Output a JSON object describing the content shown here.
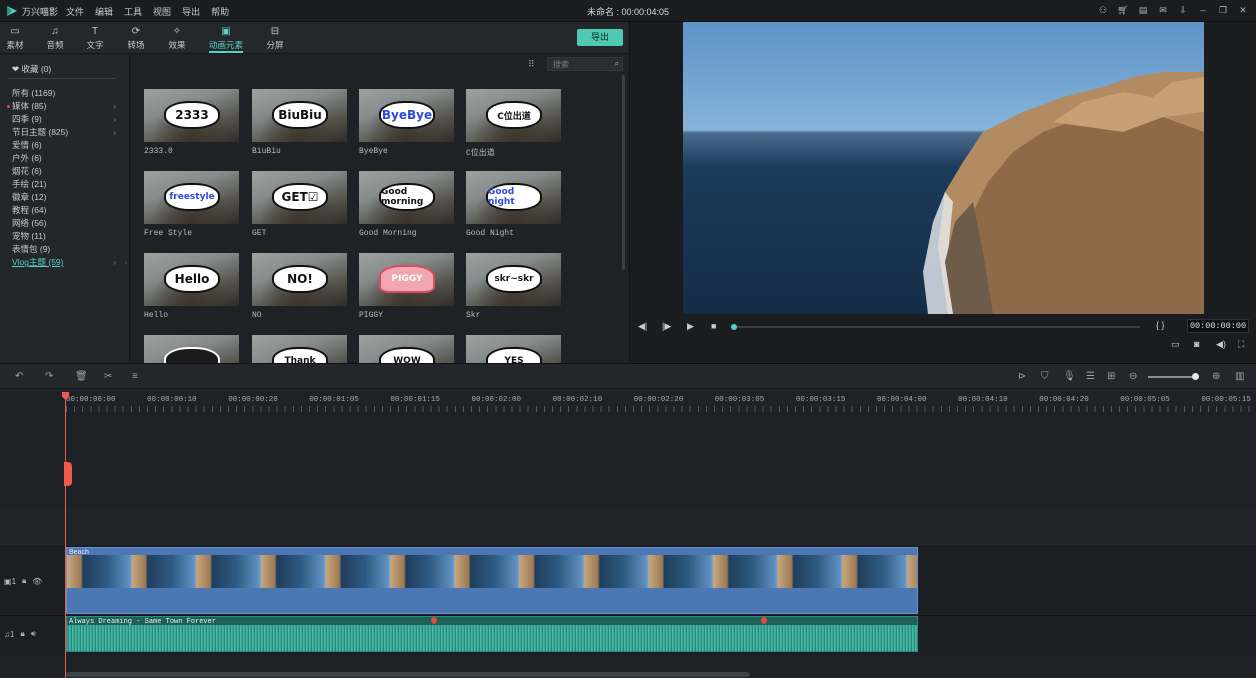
{
  "titlebar": {
    "app_name": "万兴喵影",
    "menu": [
      "文件",
      "编辑",
      "工具",
      "视图",
      "导出",
      "帮助"
    ],
    "window_title": "未命名 : 00:00:04:05"
  },
  "tabs": [
    {
      "label": "素材",
      "icon": "folder-icon",
      "glyph": "▭"
    },
    {
      "label": "音频",
      "icon": "music-note-icon",
      "glyph": "♫"
    },
    {
      "label": "文字",
      "icon": "text-icon",
      "glyph": "T"
    },
    {
      "label": "转场",
      "icon": "transition-icon",
      "glyph": "⟳"
    },
    {
      "label": "效果",
      "icon": "effects-icon",
      "glyph": "✧"
    },
    {
      "label": "动画元素",
      "icon": "image-icon",
      "glyph": "▣"
    },
    {
      "label": "分屏",
      "icon": "split-screen-icon",
      "glyph": "⊟"
    }
  ],
  "export_label": "导出",
  "sidebar": {
    "favorites": "收藏 (0)",
    "categories": [
      {
        "label": "所有 (1169)",
        "chev": ""
      },
      {
        "label": "媒体 (85)",
        "chev": "›"
      },
      {
        "label": "四季 (9)",
        "chev": "›"
      },
      {
        "label": "节日主题 (825)",
        "chev": "›"
      },
      {
        "label": "爱情 (6)",
        "chev": ""
      },
      {
        "label": "户外 (6)",
        "chev": ""
      },
      {
        "label": "烟花 (6)",
        "chev": ""
      },
      {
        "label": "手绘 (21)",
        "chev": ""
      },
      {
        "label": "徽章 (12)",
        "chev": ""
      },
      {
        "label": "教程 (64)",
        "chev": ""
      },
      {
        "label": "网络 (56)",
        "chev": ""
      },
      {
        "label": "宠物 (11)",
        "chev": ""
      },
      {
        "label": "表情包 (9)",
        "chev": ""
      },
      {
        "label": "Vlog主题 (59)",
        "chev": "›"
      }
    ]
  },
  "search": {
    "placeholder": "搜索"
  },
  "elements": [
    {
      "caption": "2333.0",
      "sticker": "2333",
      "style": ""
    },
    {
      "caption": "BiuBiu",
      "sticker": "BiuBiu",
      "style": ""
    },
    {
      "caption": "ByeBye",
      "sticker": "ByeBye",
      "style": "blue"
    },
    {
      "caption": "C位出道",
      "sticker": "C位出道",
      "style": "small"
    },
    {
      "caption": "Free Style",
      "sticker": "freestyle",
      "style": "small blue"
    },
    {
      "caption": "GET",
      "sticker": "GET☑",
      "style": ""
    },
    {
      "caption": "Good Morning",
      "sticker": "Good morning",
      "style": "small"
    },
    {
      "caption": "Good Night",
      "sticker": "Good night",
      "style": "small blue"
    },
    {
      "caption": "Hello",
      "sticker": "Hello",
      "style": ""
    },
    {
      "caption": "NO",
      "sticker": "NO!",
      "style": ""
    },
    {
      "caption": "PIGGY",
      "sticker": "PIGGY",
      "style": "pink small"
    },
    {
      "caption": "Skr",
      "sticker": "skr~skr",
      "style": "small"
    },
    {
      "caption": "",
      "sticker": "",
      "style": "dark"
    },
    {
      "caption": "",
      "sticker": "Thank",
      "style": "small"
    },
    {
      "caption": "",
      "sticker": "WOW",
      "style": "small"
    },
    {
      "caption": "",
      "sticker": "YES",
      "style": "small"
    }
  ],
  "player": {
    "timecode": "00:00:00:00",
    "progress": 0
  },
  "ruler": [
    "00:00:00:00",
    "00:00:00:10",
    "00:00:00:20",
    "00:00:01:05",
    "00:00:01:15",
    "00:00:02:00",
    "00:00:02:10",
    "00:00:02:20",
    "00:00:03:05",
    "00:00:03:15",
    "00:00:04:00",
    "00:00:04:10",
    "00:00:04:20",
    "00:00:05:05",
    "00:00:05:15"
  ],
  "tracks": {
    "video": {
      "index": "1",
      "clip_label": "Beach"
    },
    "audio": {
      "index": "1",
      "clip_label": "Always Dreaming - Same Town Forever"
    }
  },
  "colors": {
    "accent": "#56d3c4",
    "playhead": "#ef5a4a",
    "video_clip": "#4b77b4",
    "audio_clip": "#1e5f57"
  }
}
